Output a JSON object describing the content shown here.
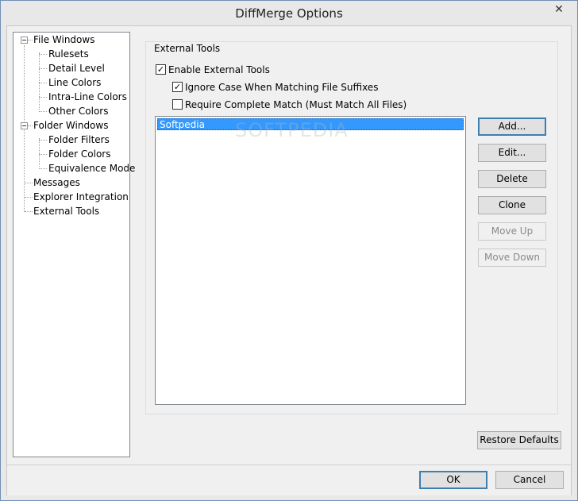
{
  "window": {
    "title": "DiffMerge Options",
    "close_glyph": "✕"
  },
  "tree": {
    "items": [
      {
        "label": "File Windows"
      },
      {
        "label": "Rulesets"
      },
      {
        "label": "Detail Level"
      },
      {
        "label": "Line Colors"
      },
      {
        "label": "Intra-Line Colors"
      },
      {
        "label": "Other Colors"
      },
      {
        "label": "Folder Windows"
      },
      {
        "label": "Folder Filters"
      },
      {
        "label": "Folder Colors"
      },
      {
        "label": "Equivalence Mode"
      },
      {
        "label": "Messages"
      },
      {
        "label": "Explorer Integration"
      },
      {
        "label": "External Tools"
      }
    ],
    "selected": "External Tools"
  },
  "panel": {
    "group_label": "External Tools",
    "enable_external_tools": {
      "label": "Enable External Tools",
      "checked": true,
      "mark": "✓"
    },
    "ignore_case": {
      "label": "Ignore Case When Matching File Suffixes",
      "checked": true,
      "mark": "✓"
    },
    "require_complete_match": {
      "label": "Require Complete Match (Must Match All Files)",
      "checked": false,
      "mark": ""
    },
    "tools_list": [
      "Softpedia"
    ],
    "watermark": "SOFTPEDIA",
    "buttons": {
      "add": "Add...",
      "edit": "Edit...",
      "delete": "Delete",
      "clone": "Clone",
      "move_up": "Move Up",
      "move_down": "Move Down"
    },
    "restore_defaults": "Restore Defaults"
  },
  "footer": {
    "ok": "OK",
    "cancel": "Cancel"
  },
  "colors": {
    "selection": "#3399ff",
    "dialog_bg": "#f0f0f0",
    "title_bg": "#e8e8e8"
  }
}
